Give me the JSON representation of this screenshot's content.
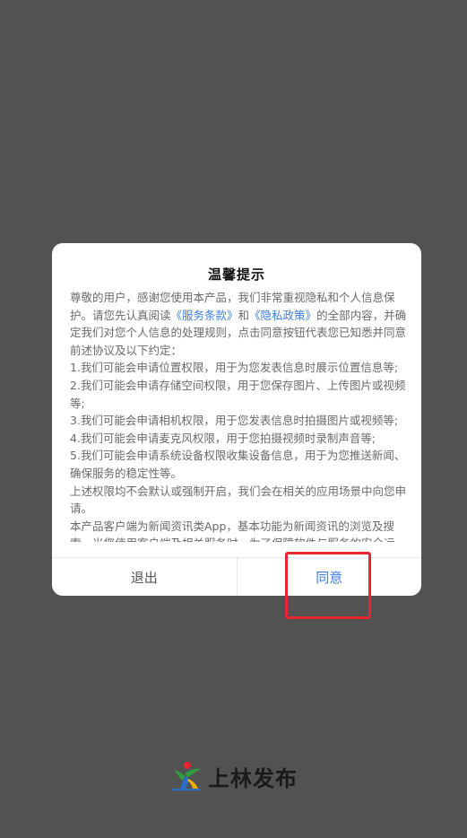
{
  "dialog": {
    "title": "温馨提示",
    "intro_before": "尊敬的用户，感谢您使用本产品，我们非常重视隐私和个人信息保护。请您先认真阅读",
    "link_terms": "《服务条款》",
    "intro_and": "和",
    "link_privacy": "《隐私政策》",
    "intro_after": "的全部内容，并确定我们对您个人信息的处理规则，点击同意按钮代表您已知悉并同意前述协议及以下约定：",
    "items": [
      "1.我们可能会申请位置权限，用于为您发表信息时展示位置信息等;",
      "2.我们可能会申请存储空间权限，用于您保存图片、上传图片或视频等;",
      "3.我们可能会申请相机权限，用于您发表信息时拍摄图片或视频等;",
      "4.我们可能会申请麦克风权限，用于您拍摄视频时录制声音等;",
      "5.我们可能会申请系统设备权限收集设备信息，用于为您推送新闻、确保服务的稳定性等。"
    ],
    "notice": "上述权限均不会默认或强制开启，我们会在相关的应用场景中向您申请。",
    "product_desc": "本产品客户端为新闻资讯类App，基本功能为新闻资讯的浏览及搜索，当您使用客户端及相关服务时，为了保障软件与服务的安全运",
    "exit_label": "退出",
    "agree_label": "同意"
  },
  "brand": {
    "name": "上林发布",
    "logo_icon": "leaping-figure-logo"
  },
  "colors": {
    "overlay": "#525252",
    "link": "#3b7ddd",
    "highlight": "#e8262d"
  }
}
